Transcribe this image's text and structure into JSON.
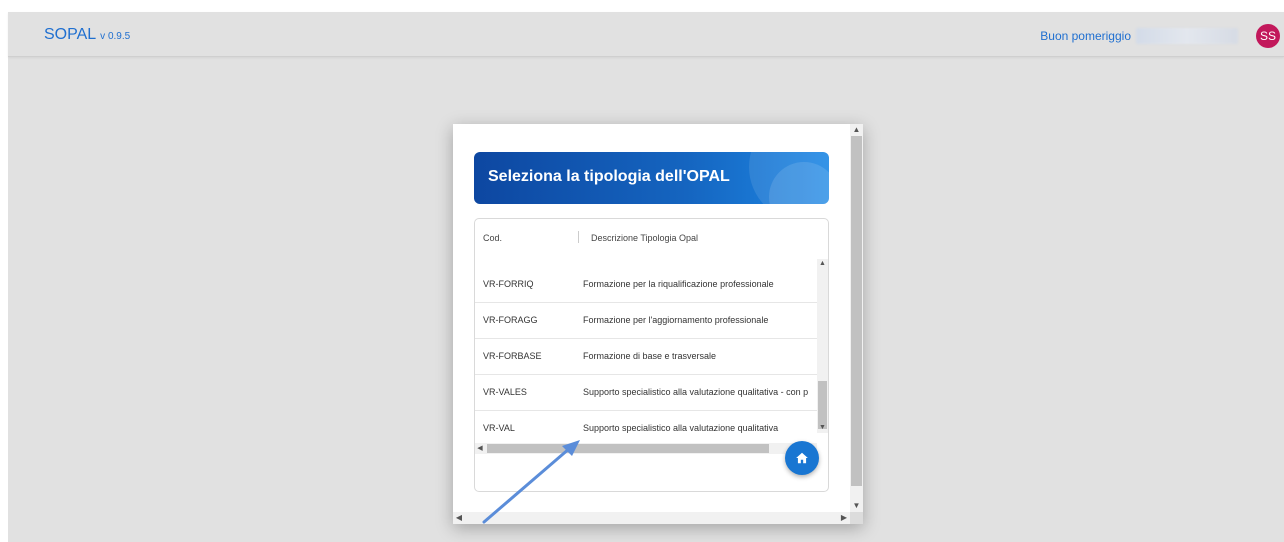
{
  "header": {
    "app_name": "SOPAL",
    "version": "v 0.9.5",
    "greeting": "Buon pomeriggio",
    "avatar_initials": "SS",
    "avatar_color": "#c2185b",
    "brand_color": "#1f6fd0"
  },
  "dialog": {
    "title": "Seleziona la tipologia dell'OPAL",
    "table": {
      "columns": [
        "Cod.",
        "Descrizione Tipologia Opal"
      ],
      "rows": [
        {
          "cod": "VR-FORRIQ",
          "desc": "Formazione per la riqualificazione professionale"
        },
        {
          "cod": "VR-FORAGG",
          "desc": "Formazione per l'aggiornamento professionale"
        },
        {
          "cod": "VR-FORBASE",
          "desc": "Formazione di base e trasversale"
        },
        {
          "cod": "VR-VALES",
          "desc": "Supporto specialistico alla valutazione qualitativa - con p"
        },
        {
          "cod": "VR-VAL",
          "desc": "Supporto specialistico alla valutazione qualitativa"
        }
      ]
    },
    "fab_icon": "home-icon"
  },
  "annotation": {
    "icon": "arrow-annotation-icon",
    "color": "#5b8dd9"
  }
}
